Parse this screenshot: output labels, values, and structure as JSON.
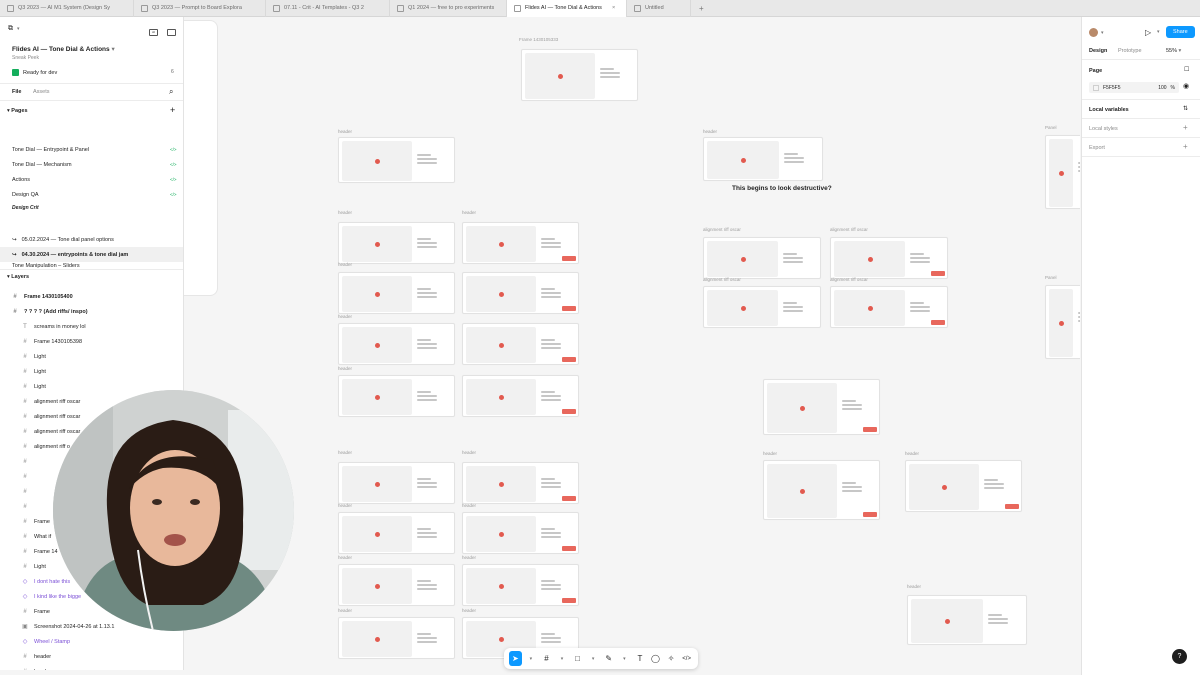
{
  "tabs": [
    {
      "label": "Q3 2023 — AI M1 System (Design Sy",
      "active": false
    },
    {
      "label": "Q3 2023 — Prompt to Board Explora",
      "active": false
    },
    {
      "label": "07.11 - Crit - AI Templates - Q3 2",
      "active": false
    },
    {
      "label": "Q1 2024 — free to pro experiments",
      "active": false
    },
    {
      "label": "Flides AI — Tone Dial & Actions",
      "active": true
    },
    {
      "label": "Untitled",
      "active": false
    }
  ],
  "file": {
    "title": "Flides AI — Tone Dial & Actions",
    "subtitle": "Sneak Peek",
    "status": "Ready for dev",
    "status_count": "6"
  },
  "panel_tabs": {
    "file": "File",
    "assets": "Assets"
  },
  "pages": {
    "header": "Pages",
    "items": [
      "Tone Dial — Entrypoint & Panel",
      "Tone Dial — Mechanism",
      "Actions",
      "Design QA"
    ],
    "section": "Design Crit",
    "crit_items": [
      "05.02.2024 — Tone dial panel options",
      "04.30.2024 — entrypoints & tone dial jam"
    ],
    "cutoff": "Tone Manipulation – Sliders"
  },
  "layers": {
    "header": "Layers",
    "items": [
      {
        "label": "Frame 1430105400",
        "kind": "frame",
        "indent": 0
      },
      {
        "label": "? ? ? ?  (Add riffs/ inspo)",
        "kind": "frame",
        "indent": 0
      },
      {
        "label": "screams in money lol",
        "kind": "text",
        "indent": 1
      },
      {
        "label": "Frame 1430105398",
        "kind": "frame",
        "indent": 1
      },
      {
        "label": "Light",
        "kind": "frame",
        "indent": 1
      },
      {
        "label": "Light",
        "kind": "frame",
        "indent": 1
      },
      {
        "label": "Light",
        "kind": "frame",
        "indent": 1
      },
      {
        "label": "alignment riff oscar",
        "kind": "frame",
        "indent": 1
      },
      {
        "label": "alignment riff oscar",
        "kind": "frame",
        "indent": 1
      },
      {
        "label": "alignment riff oscar",
        "kind": "frame",
        "indent": 1
      },
      {
        "label": "alignment riff o",
        "kind": "frame",
        "indent": 1
      },
      {
        "label": "",
        "kind": "frame",
        "indent": 1
      },
      {
        "label": "",
        "kind": "frame",
        "indent": 1
      },
      {
        "label": "",
        "kind": "frame",
        "indent": 1
      },
      {
        "label": "",
        "kind": "frame",
        "indent": 1
      },
      {
        "label": "Frame",
        "kind": "frame",
        "indent": 1
      },
      {
        "label": "What if",
        "kind": "frame",
        "indent": 1
      },
      {
        "label": "Frame 14",
        "kind": "frame",
        "indent": 1
      },
      {
        "label": "Light",
        "kind": "frame",
        "indent": 1
      },
      {
        "label": "I dont hate this",
        "kind": "comp",
        "indent": 1
      },
      {
        "label": "I kind like the bigge",
        "kind": "comp",
        "indent": 1
      },
      {
        "label": "Frame",
        "kind": "frame",
        "indent": 1
      },
      {
        "label": "Screenshot 2024-04-26 at 1.13.1",
        "kind": "image",
        "indent": 1
      },
      {
        "label": "Wheel / Stamp",
        "kind": "comp",
        "indent": 1
      },
      {
        "label": "header",
        "kind": "frame",
        "indent": 1
      },
      {
        "label": "header",
        "kind": "frame",
        "indent": 1
      }
    ]
  },
  "canvas": {
    "top_frame_label": "Frame 1430105333",
    "annotation": "This begins to look destructive?",
    "labels": {
      "header": "header",
      "riff": "alignment riff oscar",
      "panel": "Panel"
    }
  },
  "right": {
    "tabs": {
      "design": "Design",
      "prototype": "Prototype"
    },
    "zoom": "55%",
    "share": "Share",
    "page_section": "Page",
    "bg_hex": "F5F5F5",
    "bg_opacity": "100",
    "pct": "%",
    "local_variables": "Local variables",
    "local_styles": "Local styles",
    "export": "Export"
  },
  "colors": {
    "accent": "#0d99ff",
    "dial": "#e25a4f",
    "component": "#7b4fd6"
  },
  "icons": {
    "figma": "figma-logo-icon",
    "move": "move-tool-icon",
    "frame": "frame-tool-icon",
    "shape": "rectangle-tool-icon",
    "pen": "pen-tool-icon",
    "text": "text-tool-icon",
    "comment": "comment-tool-icon",
    "actions": "actions-icon",
    "dev": "dev-mode-icon"
  },
  "help": "?"
}
